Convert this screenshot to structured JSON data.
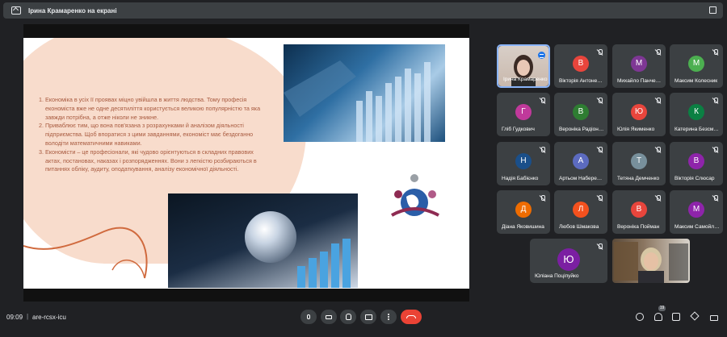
{
  "topbar": {
    "presenter_label": "Ірина Крамаренко на екрані"
  },
  "slide": {
    "items": [
      "Економіка в усіх її проявах міцно увійшла в життя людства. Тому професія економіста вже не одне десятиліття користується великою популярністю та яка завжди потрібна, а отже ніколи не зникне.",
      "Приваблює тим, що вона пов'язана з розрахунками й аналізом діяльності підприємства. Щоб впоратися з цими завданнями, економіст має бездоганно володіти математичними навиками.",
      "Економісти – це професіонали, які чудово орієнтуються в складних правових актах, постановах, наказах і розпорядженнях. Вони з легкістю розбираються в питаннях обліку, аудиту, оподаткування, аналізу економічної діяльності."
    ]
  },
  "participants": [
    {
      "name": "Ірина Крамаренко",
      "initial": "",
      "color": ""
    },
    {
      "name": "Вікторія Антоненко",
      "initial": "В",
      "color": "#e8453c"
    },
    {
      "name": "Михайло Панченко",
      "initial": "М",
      "color": "#7e3794"
    },
    {
      "name": "Максим Колесник",
      "initial": "М",
      "color": "#4caf50"
    },
    {
      "name": "Гліб Гудкович",
      "initial": "Г",
      "color": "#c0399b"
    },
    {
      "name": "Вероніка Радіонова",
      "initial": "В",
      "color": "#2e7d32"
    },
    {
      "name": "Юлія Якименко",
      "initial": "Ю",
      "color": "#e8453c"
    },
    {
      "name": "Катерина Безсмертна",
      "initial": "К",
      "color": "#0b8043"
    },
    {
      "name": "Надія Бабієнко",
      "initial": "Н",
      "color": "#1a4f8a"
    },
    {
      "name": "Артьом Набережний",
      "initial": "А",
      "color": "#5c6bc0"
    },
    {
      "name": "Тетяна Демченко",
      "initial": "Т",
      "color": "#78909c"
    },
    {
      "name": "Вікторія Слюсар",
      "initial": "В",
      "color": "#8e24aa"
    },
    {
      "name": "Діана Яковишина",
      "initial": "Д",
      "color": "#ef6c00"
    },
    {
      "name": "Любов Шмакова",
      "initial": "Л",
      "color": "#f4511e"
    },
    {
      "name": "Вероніка Пойман",
      "initial": "В",
      "color": "#e8453c"
    },
    {
      "name": "Максим Самойленко",
      "initial": "М",
      "color": "#8e24aa"
    },
    {
      "name": "Юліана Поціпуйко",
      "initial": "Ю",
      "color": "#7b1fa2"
    }
  ],
  "bottom": {
    "time": "09:09",
    "separator": "|",
    "meeting_code": "are-rcsx-icu",
    "participant_count": "19"
  },
  "colors": {
    "background": "#202124",
    "tile": "#3c4043",
    "end_call": "#ea4335",
    "active_border": "#8ab4f8"
  },
  "icons": [
    "present-icon",
    "fullscreen-icon",
    "mic-icon",
    "camera-icon",
    "raise-hand-icon",
    "present-screen-icon",
    "more-options-icon",
    "end-call-icon",
    "info-icon",
    "people-icon",
    "chat-icon",
    "activities-icon",
    "host-controls-icon"
  ]
}
